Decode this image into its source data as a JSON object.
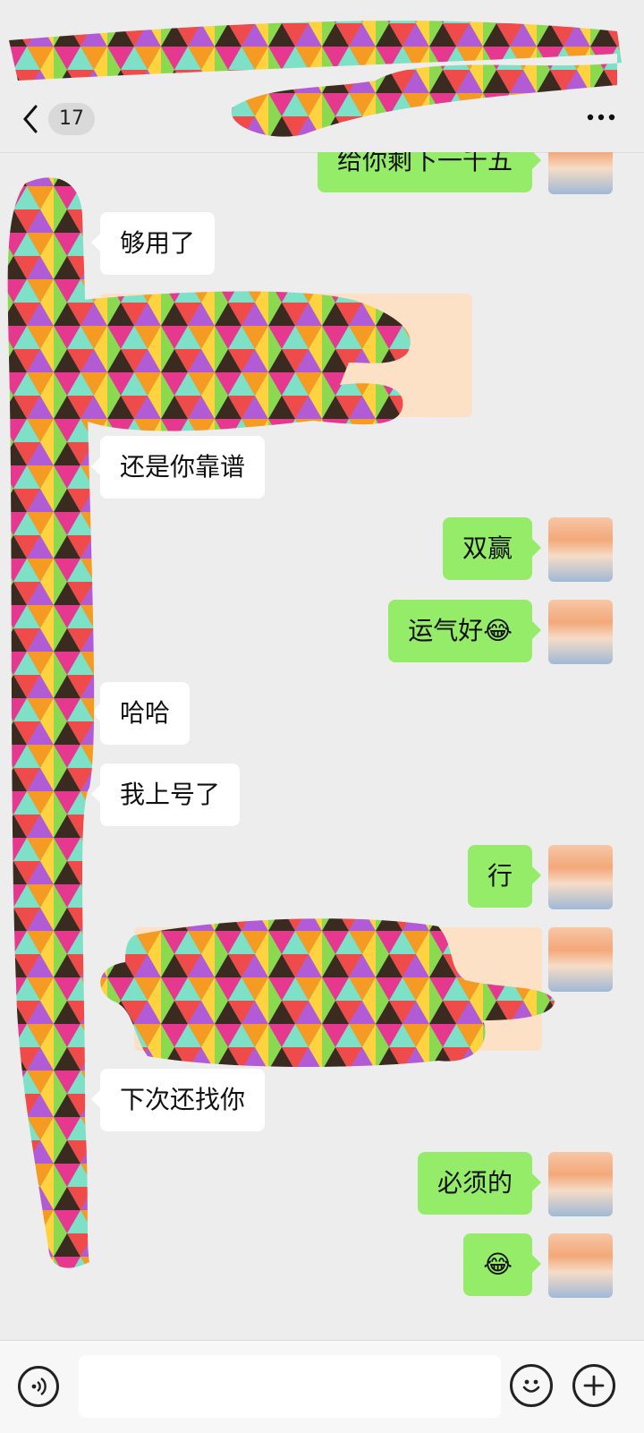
{
  "header": {
    "unread_count": "17"
  },
  "icons": {
    "back": "chevron-left-icon",
    "more": "more-dots-icon",
    "voice": "voice-icon",
    "emoji": "smiley-icon",
    "plus": "plus-icon"
  },
  "colors": {
    "background": "#ededed",
    "outgoing_bubble": "#95ec69",
    "incoming_bubble": "#ffffff"
  },
  "messages": [
    {
      "side": "right",
      "text": "给你剩下一千五"
    },
    {
      "side": "left",
      "text": "够用了"
    },
    {
      "side": "left",
      "text": "还是你靠谱"
    },
    {
      "side": "right",
      "text": "双赢"
    },
    {
      "side": "right",
      "text": "运气好😂"
    },
    {
      "side": "left",
      "text": "哈哈"
    },
    {
      "side": "left",
      "text": "我上号了"
    },
    {
      "side": "right",
      "text": "行"
    },
    {
      "side": "left",
      "text": "下次还找你"
    },
    {
      "side": "right",
      "text": "必须的"
    },
    {
      "side": "right",
      "text": "😂"
    }
  ],
  "input": {
    "value": ""
  }
}
